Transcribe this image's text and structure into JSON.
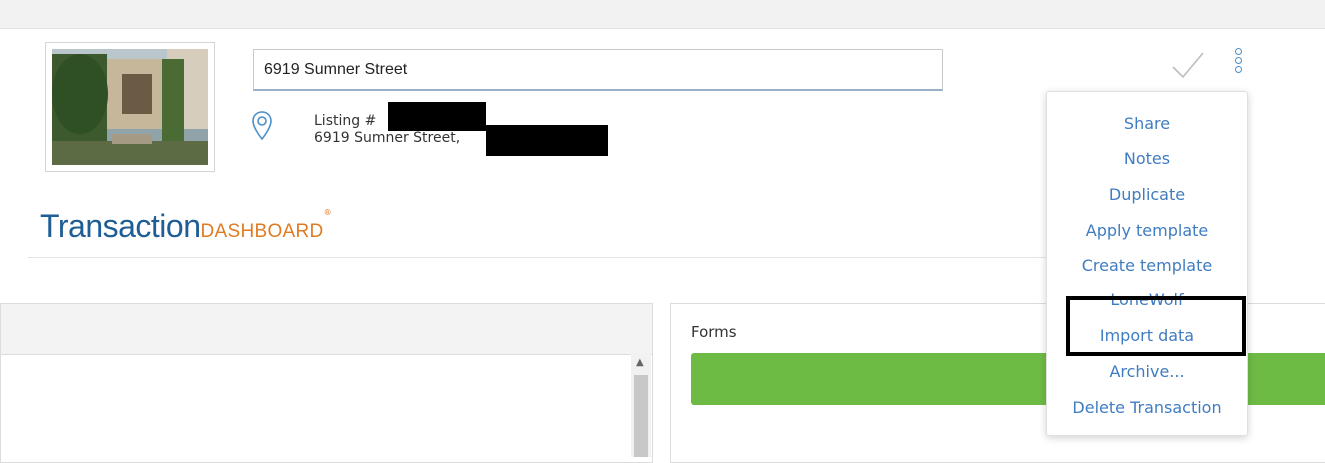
{
  "transaction": {
    "name_value": "6919 Sumner Street",
    "listing_label": "Listing #",
    "address_line": "6919 Sumner Street,"
  },
  "logo": {
    "main": "Transaction",
    "sub": "DASHBOARD",
    "reg": "®"
  },
  "icons": {
    "location": "map-pin-icon",
    "check": "checkmark-icon",
    "more": "vertical-ellipsis-icon"
  },
  "forms_panel": {
    "title": "Forms"
  },
  "menu": {
    "items": [
      "Share",
      "Notes",
      "Duplicate",
      "Apply template",
      "Create template",
      "LoneWolf",
      "Import data",
      "Archive...",
      "Delete Transaction"
    ]
  },
  "colors": {
    "menu_link": "#3f7cc0",
    "logo_blue": "#1e5e95",
    "logo_orange": "#e07b22",
    "forms_bar": "#6dbb45"
  }
}
